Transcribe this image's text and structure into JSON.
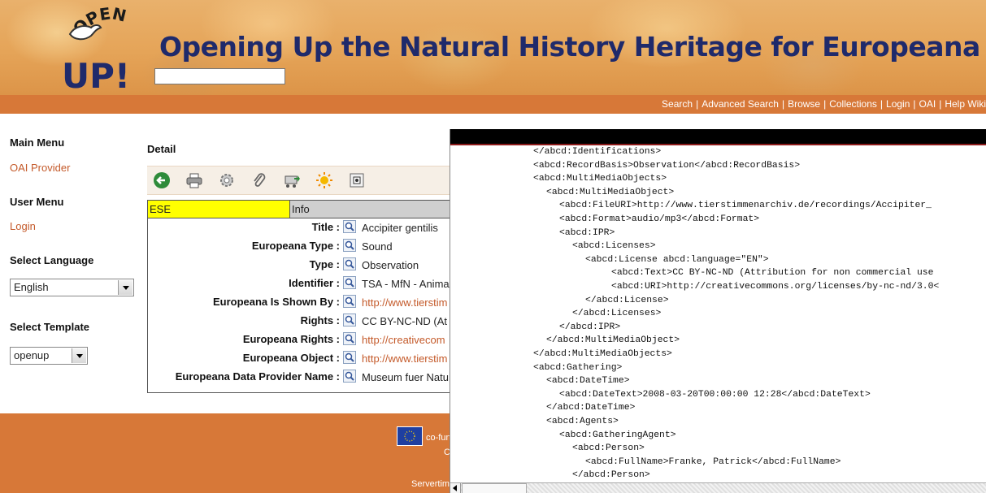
{
  "header": {
    "title": "Opening Up the Natural History Heritage for Europeana",
    "logo_text_main": "UP!",
    "logo_text_arc": "OPEN",
    "search_value": ""
  },
  "nav": {
    "links": [
      "Search",
      "Advanced Search",
      "Browse",
      "Collections",
      "Login",
      "OAI",
      "Help Wiki"
    ],
    "separator": "|"
  },
  "sidebar": {
    "main_menu_heading": "Main Menu",
    "main_menu_item": "OAI Provider",
    "user_menu_heading": "User Menu",
    "user_menu_item": "Login",
    "language_heading": "Select Language",
    "language_value": "English",
    "template_heading": "Select Template",
    "template_value": "openup"
  },
  "detail": {
    "heading": "Detail",
    "toolbar_icons": [
      "back-arrow-icon",
      "print-icon",
      "settings-icon",
      "attachment-icon",
      "cart-icon",
      "sun-icon",
      "document-icon"
    ],
    "tabs": {
      "ese": "ESE",
      "info": "Info"
    },
    "rows": [
      {
        "label": "Title :",
        "value": "Accipiter gentilis",
        "link": false
      },
      {
        "label": "Europeana Type :",
        "value": "Sound",
        "link": false
      },
      {
        "label": "Type :",
        "value": "Observation",
        "link": false
      },
      {
        "label": "Identifier :",
        "value": "TSA - MfN - Anima",
        "link": false
      },
      {
        "label": "Europeana Is Shown By :",
        "value": "http://www.tierstim",
        "link": true
      },
      {
        "label": "Rights :",
        "value": "CC BY-NC-ND (At",
        "link": false
      },
      {
        "label": "Europeana Rights :",
        "value": "http://creativecom",
        "link": true
      },
      {
        "label": "Europeana Object :",
        "value": "http://www.tierstim",
        "link": true
      },
      {
        "label": "Europeana Data Provider Name :",
        "value": "Museum fuer Natu",
        "link": false
      }
    ]
  },
  "footer": {
    "cofunded": "co-fun",
    "c": "C",
    "servertime": "Servertim"
  },
  "xml": {
    "lines": [
      {
        "indent": 0,
        "text": "</abcd:Identifications>"
      },
      {
        "indent": 0,
        "text": "<abcd:RecordBasis>Observation</abcd:RecordBasis>"
      },
      {
        "indent": 0,
        "text": "<abcd:MultiMediaObjects>"
      },
      {
        "indent": 1,
        "text": "<abcd:MultiMediaObject>"
      },
      {
        "indent": 2,
        "text": "<abcd:FileURI>http://www.tierstimmenarchiv.de/recordings/Accipiter_"
      },
      {
        "indent": 2,
        "text": "<abcd:Format>audio/mp3</abcd:Format>"
      },
      {
        "indent": 2,
        "text": "<abcd:IPR>"
      },
      {
        "indent": 3,
        "text": "<abcd:Licenses>"
      },
      {
        "indent": 4,
        "text": "<abcd:License abcd:language=\"EN\">"
      },
      {
        "indent": 6,
        "text": "<abcd:Text>CC BY-NC-ND (Attribution for non commercial use"
      },
      {
        "indent": 6,
        "text": "<abcd:URI>http://creativecommons.org/licenses/by-nc-nd/3.0<"
      },
      {
        "indent": 4,
        "text": "</abcd:License>"
      },
      {
        "indent": 3,
        "text": "</abcd:Licenses>"
      },
      {
        "indent": 2,
        "text": "</abcd:IPR>"
      },
      {
        "indent": 1,
        "text": "</abcd:MultiMediaObject>"
      },
      {
        "indent": 0,
        "text": "</abcd:MultiMediaObjects>"
      },
      {
        "indent": 0,
        "text": "<abcd:Gathering>"
      },
      {
        "indent": 1,
        "text": "<abcd:DateTime>"
      },
      {
        "indent": 2,
        "text": "<abcd:DateText>2008-03-20T00:00:00 12:28</abcd:DateText>"
      },
      {
        "indent": 1,
        "text": "</abcd:DateTime>"
      },
      {
        "indent": 1,
        "text": "<abcd:Agents>"
      },
      {
        "indent": 2,
        "text": "<abcd:GatheringAgent>"
      },
      {
        "indent": 3,
        "text": "<abcd:Person>"
      },
      {
        "indent": 4,
        "text": "<abcd:FullName>Franke, Patrick</abcd:FullName>"
      },
      {
        "indent": 3,
        "text": "</abcd:Person>"
      }
    ]
  },
  "colors": {
    "nav_bar": "#d77838",
    "link": "#c45a2a",
    "title": "#1f2a6b",
    "ese_tab": "#ffff00",
    "info_tab": "#cfcfcf"
  }
}
